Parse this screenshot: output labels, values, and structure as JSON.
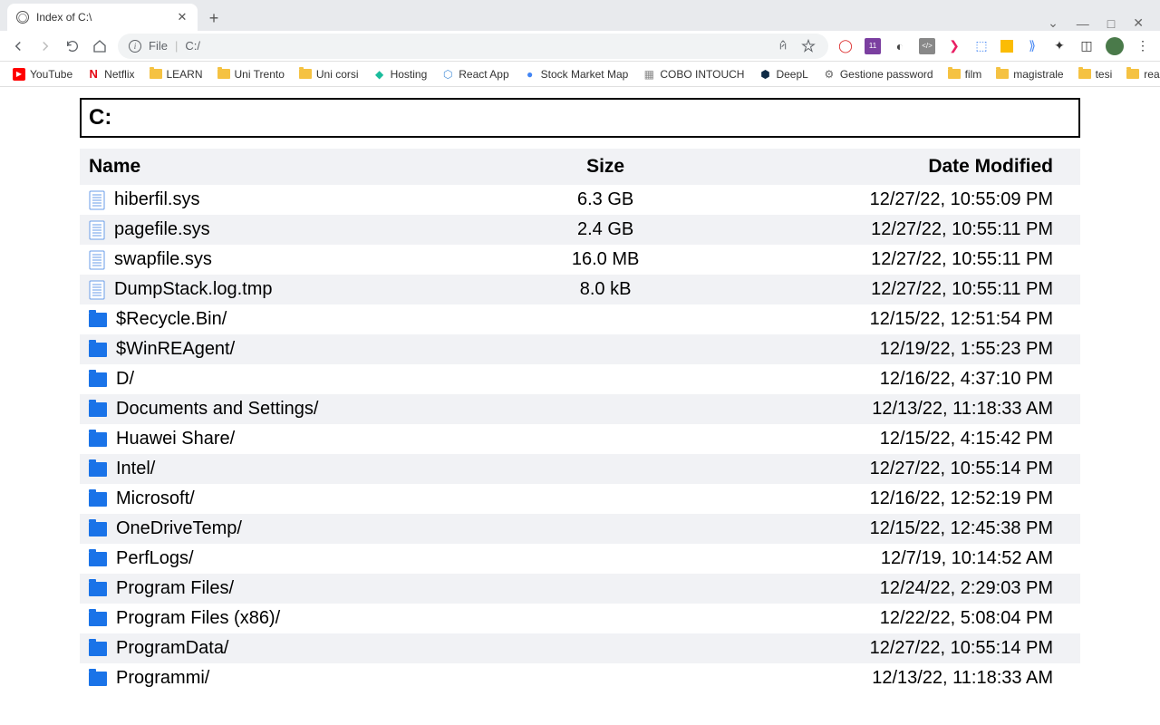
{
  "tab": {
    "title": "Index of C:\\"
  },
  "window_controls": {
    "min": "—",
    "max": "□",
    "close": "✕",
    "dropdown": "⌄"
  },
  "toolbar": {
    "file_label": "File",
    "url_path": "C:/"
  },
  "bookmarks": [
    {
      "label": "YouTube",
      "icon": "youtube"
    },
    {
      "label": "Netflix",
      "icon": "netflix"
    },
    {
      "label": "LEARN",
      "icon": "folder"
    },
    {
      "label": "Uni Trento",
      "icon": "folder"
    },
    {
      "label": "Uni corsi",
      "icon": "folder"
    },
    {
      "label": "Hosting",
      "icon": "diamond"
    },
    {
      "label": "React App",
      "icon": "react"
    },
    {
      "label": "Stock Market Map",
      "icon": "blue"
    },
    {
      "label": "COBO INTOUCH",
      "icon": "squares"
    },
    {
      "label": "DeepL",
      "icon": "deepl"
    },
    {
      "label": "Gestione password",
      "icon": "gear"
    },
    {
      "label": "film",
      "icon": "folder"
    },
    {
      "label": "magistrale",
      "icon": "folder"
    },
    {
      "label": "tesi",
      "icon": "folder"
    },
    {
      "label": "reading",
      "icon": "folder"
    }
  ],
  "listing": {
    "path": "C:",
    "headers": {
      "name": "Name",
      "size": "Size",
      "date": "Date Modified"
    },
    "items": [
      {
        "type": "file",
        "name": "hiberfil.sys",
        "size": "6.3 GB",
        "date": "12/27/22, 10:55:09 PM"
      },
      {
        "type": "file",
        "name": "pagefile.sys",
        "size": "2.4 GB",
        "date": "12/27/22, 10:55:11 PM"
      },
      {
        "type": "file",
        "name": "swapfile.sys",
        "size": "16.0 MB",
        "date": "12/27/22, 10:55:11 PM"
      },
      {
        "type": "file",
        "name": "DumpStack.log.tmp",
        "size": "8.0 kB",
        "date": "12/27/22, 10:55:11 PM"
      },
      {
        "type": "folder",
        "name": "$Recycle.Bin/",
        "size": "",
        "date": "12/15/22, 12:51:54 PM"
      },
      {
        "type": "folder",
        "name": "$WinREAgent/",
        "size": "",
        "date": "12/19/22, 1:55:23 PM"
      },
      {
        "type": "folder",
        "name": "D/",
        "size": "",
        "date": "12/16/22, 4:37:10 PM"
      },
      {
        "type": "folder",
        "name": "Documents and Settings/",
        "size": "",
        "date": "12/13/22, 11:18:33 AM"
      },
      {
        "type": "folder",
        "name": "Huawei Share/",
        "size": "",
        "date": "12/15/22, 4:15:42 PM"
      },
      {
        "type": "folder",
        "name": "Intel/",
        "size": "",
        "date": "12/27/22, 10:55:14 PM"
      },
      {
        "type": "folder",
        "name": "Microsoft/",
        "size": "",
        "date": "12/16/22, 12:52:19 PM"
      },
      {
        "type": "folder",
        "name": "OneDriveTemp/",
        "size": "",
        "date": "12/15/22, 12:45:38 PM"
      },
      {
        "type": "folder",
        "name": "PerfLogs/",
        "size": "",
        "date": "12/7/19, 10:14:52 AM"
      },
      {
        "type": "folder",
        "name": "Program Files/",
        "size": "",
        "date": "12/24/22, 2:29:03 PM"
      },
      {
        "type": "folder",
        "name": "Program Files (x86)/",
        "size": "",
        "date": "12/22/22, 5:08:04 PM"
      },
      {
        "type": "folder",
        "name": "ProgramData/",
        "size": "",
        "date": "12/27/22, 10:55:14 PM"
      },
      {
        "type": "folder",
        "name": "Programmi/",
        "size": "",
        "date": "12/13/22, 11:18:33 AM"
      }
    ]
  }
}
